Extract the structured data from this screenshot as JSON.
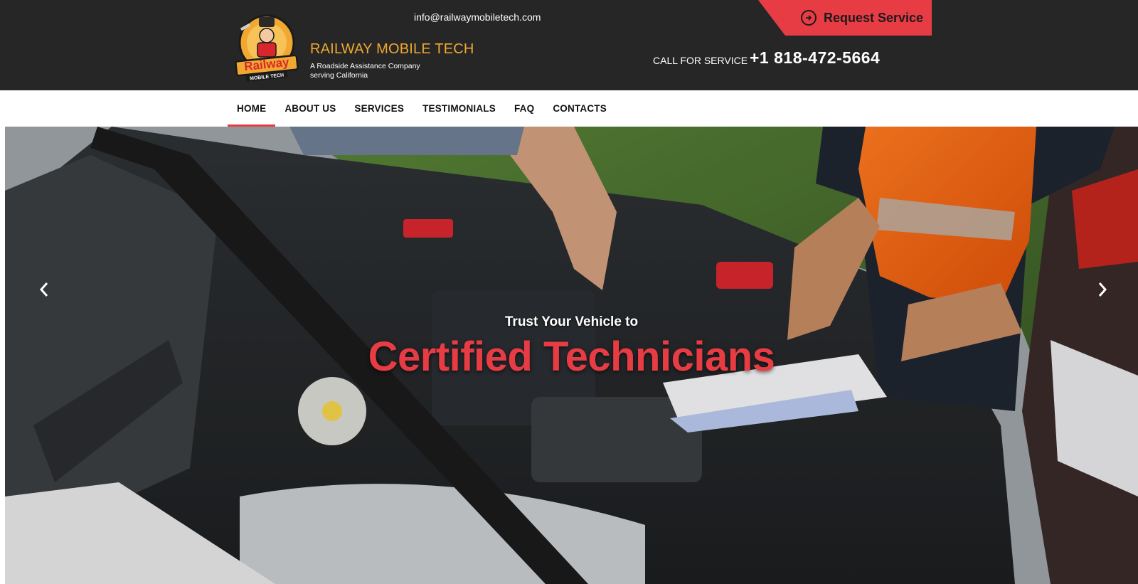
{
  "header": {
    "email": "info@railwaymobiletech.com",
    "request_label": "Request Service",
    "brand_name": "RAILWAY MOBILE TECH",
    "brand_tagline_line1": "A Roadside Assistance Company",
    "brand_tagline_line2": "serving California",
    "call_label": "CALL FOR SERVICE",
    "phone": "+1 818-472-5664",
    "logo_text_top": "Railway",
    "logo_text_bottom": "MOBILE TECH",
    "accent_color": "#e83c45",
    "brand_color": "#f0a830"
  },
  "nav": {
    "items": [
      {
        "label": "HOME"
      },
      {
        "label": "ABOUT US"
      },
      {
        "label": "SERVICES"
      },
      {
        "label": "TESTIMONIALS"
      },
      {
        "label": "FAQ"
      },
      {
        "label": "CONTACTS"
      }
    ],
    "active": "HOME"
  },
  "hero": {
    "subtitle": "Trust Your Vehicle to",
    "title": "Certified Technicians",
    "prev_icon": "chevron-left-icon",
    "next_icon": "chevron-right-icon"
  }
}
